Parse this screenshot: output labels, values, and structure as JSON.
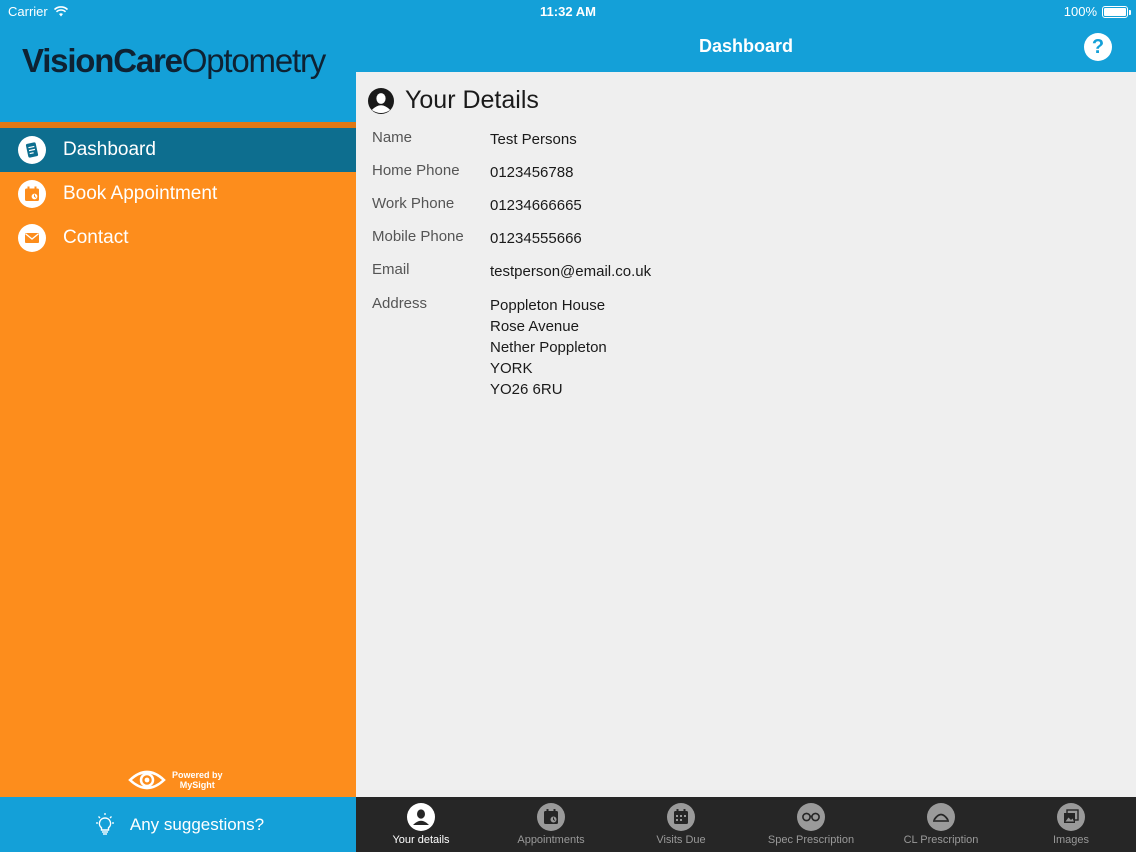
{
  "status_bar": {
    "carrier": "Carrier",
    "time": "11:32 AM",
    "battery": "100%"
  },
  "sidebar": {
    "logo_bold": "VisionCare",
    "logo_regular": "Optometry",
    "menu": [
      {
        "label": "Dashboard",
        "icon": "dashboard-icon",
        "active": true
      },
      {
        "label": "Book Appointment",
        "icon": "calendar-icon",
        "active": false
      },
      {
        "label": "Contact",
        "icon": "mail-icon",
        "active": false
      }
    ],
    "powered_by_line1": "Powered by",
    "powered_by_line2": "MySight",
    "suggestions_label": "Any suggestions?"
  },
  "header": {
    "title": "Dashboard",
    "help_symbol": "?"
  },
  "details": {
    "title": "Your Details",
    "name_label": "Name",
    "name_value": "Test Persons",
    "home_phone_label": "Home Phone",
    "home_phone_value": "0123456788",
    "work_phone_label": "Work Phone",
    "work_phone_value": "01234666665",
    "mobile_phone_label": "Mobile Phone",
    "mobile_phone_value": "01234555666",
    "email_label": "Email",
    "email_value": "testperson@email.co.uk",
    "address_label": "Address",
    "address_lines": [
      "Poppleton House",
      "Rose Avenue",
      "Nether Poppleton",
      "YORK",
      "YO26 6RU"
    ]
  },
  "tabs": [
    {
      "label": "Your details",
      "icon": "person-icon",
      "active": true
    },
    {
      "label": "Appointments",
      "icon": "calendar-clock-icon",
      "active": false
    },
    {
      "label": "Visits Due",
      "icon": "calendar-icon",
      "active": false
    },
    {
      "label": "Spec Prescription",
      "icon": "glasses-icon",
      "active": false
    },
    {
      "label": "CL Prescription",
      "icon": "contact-lens-icon",
      "active": false
    },
    {
      "label": "Images",
      "icon": "images-icon",
      "active": false
    }
  ],
  "colors": {
    "brand_blue": "#14a0d8",
    "sidebar_orange": "#fd8d1c",
    "active_menu": "#0d6e8f",
    "tabbar": "#262626"
  }
}
